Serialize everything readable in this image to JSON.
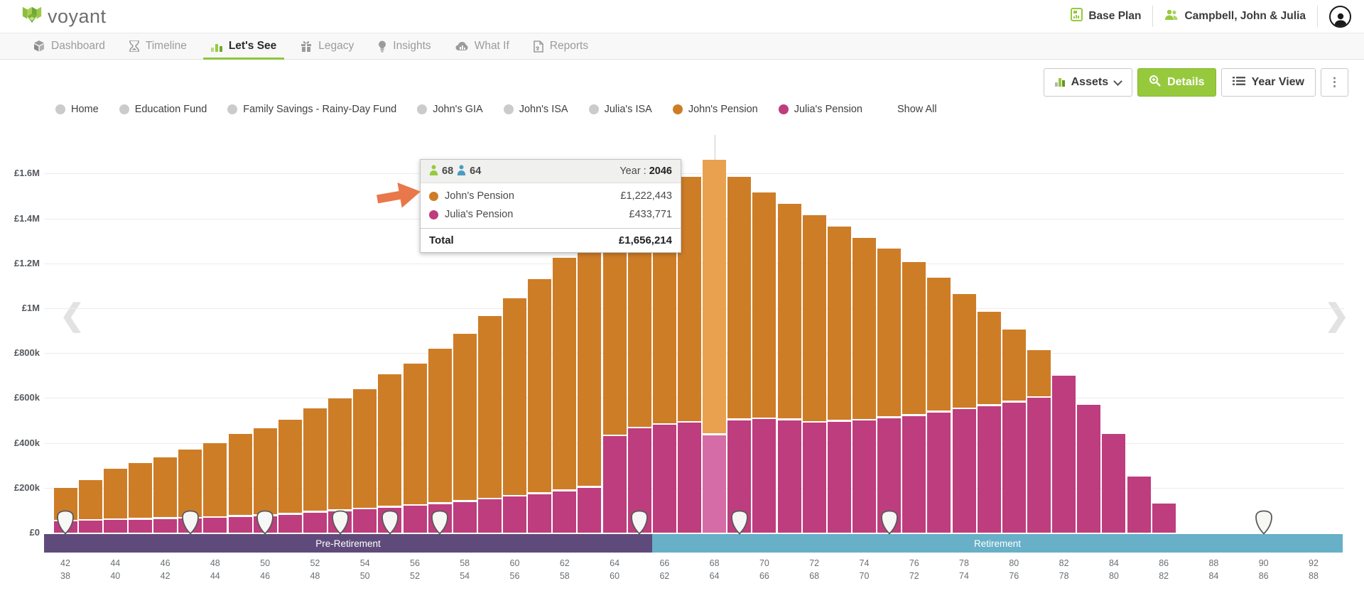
{
  "header": {
    "logo_text": "voyant",
    "plan_label": "Base Plan",
    "client_name": "Campbell, John & Julia"
  },
  "nav": {
    "items": [
      {
        "label": "Dashboard",
        "icon": "dashboard-cube-icon",
        "active": false
      },
      {
        "label": "Timeline",
        "icon": "hourglass-icon",
        "active": false
      },
      {
        "label": "Let's See",
        "icon": "bar-chart-icon",
        "active": true
      },
      {
        "label": "Legacy",
        "icon": "gift-icon",
        "active": false
      },
      {
        "label": "Insights",
        "icon": "lightbulb-icon",
        "active": false
      },
      {
        "label": "What If",
        "icon": "cloud-chart-icon",
        "active": false
      },
      {
        "label": "Reports",
        "icon": "report-document-icon",
        "active": false
      }
    ]
  },
  "toolbar": {
    "assets_label": "Assets",
    "details_label": "Details",
    "year_view_label": "Year View",
    "kebab_glyph": "⋮"
  },
  "legend": {
    "items": [
      {
        "label": "Home",
        "color": "#cbcbcb"
      },
      {
        "label": "Education Fund",
        "color": "#cbcbcb"
      },
      {
        "label": "Family Savings - Rainy-Day Fund",
        "color": "#cbcbcb"
      },
      {
        "label": "John's GIA",
        "color": "#cbcbcb"
      },
      {
        "label": "John's ISA",
        "color": "#cbcbcb"
      },
      {
        "label": "Julia's ISA",
        "color": "#cbcbcb"
      },
      {
        "label": "John's Pension",
        "color": "#ce7d27"
      },
      {
        "label": "Julia's Pension",
        "color": "#be3d7e"
      }
    ],
    "show_all_label": "Show All"
  },
  "tooltip": {
    "age_primary": "68",
    "age_secondary": "64",
    "year_label": "Year :",
    "year_value": "2046",
    "rows": [
      {
        "label": "John's Pension",
        "value": "£1,222,443",
        "color": "#ce7d27"
      },
      {
        "label": "Julia's Pension",
        "value": "£433,771",
        "color": "#be3d7e"
      }
    ],
    "total_label": "Total",
    "total_value": "£1,656,214"
  },
  "chart_data": {
    "type": "bar",
    "stacked": true,
    "title": "Let's See - Assets detail chart",
    "age_start_john": 42,
    "age_start_julia": 38,
    "series": [
      {
        "name": "Julia's Pension",
        "stack": "bottom",
        "color": "#be3d7e",
        "highlight_color": "#d66ca7",
        "values": [
          50000,
          53000,
          57000,
          58000,
          60000,
          63000,
          66000,
          70000,
          73000,
          80000,
          89000,
          96000,
          104000,
          112000,
          120000,
          128000,
          136000,
          148000,
          160000,
          172000,
          185000,
          200000,
          430000,
          465000,
          480000,
          490000,
          433771,
          500000,
          505000,
          500000,
          490000,
          495000,
          500000,
          510000,
          520000,
          535000,
          550000,
          565000,
          580000,
          600000,
          700000,
          570000,
          440000,
          250000,
          130000
        ]
      },
      {
        "name": "John's Pension",
        "stack": "top",
        "color": "#ce7d27",
        "highlight_color": "#e9a14f",
        "values": [
          145000,
          177000,
          223000,
          247000,
          270000,
          302000,
          329000,
          365000,
          387000,
          420000,
          461000,
          499000,
          531000,
          588000,
          630000,
          687000,
          744000,
          812000,
          880000,
          953000,
          1035000,
          1100000,
          960000,
          1010000,
          1065000,
          1090000,
          1222443,
          1080000,
          1005000,
          960000,
          920000,
          865000,
          810000,
          750000,
          680000,
          595000,
          510000,
          415000,
          320000,
          210000,
          0,
          0,
          0,
          0,
          0
        ]
      }
    ],
    "highlight_index": 26,
    "highlight_year": 2046,
    "ylim": [
      0,
      1700000
    ],
    "yticks": [
      {
        "label": "£0",
        "value": 0
      },
      {
        "label": "£200k",
        "value": 200000
      },
      {
        "label": "£400k",
        "value": 400000
      },
      {
        "label": "£600k",
        "value": 600000
      },
      {
        "label": "£800k",
        "value": 800000
      },
      {
        "label": "£1M",
        "value": 1000000
      },
      {
        "label": "£1.2M",
        "value": 1200000
      },
      {
        "label": "£1.4M",
        "value": 1400000
      },
      {
        "label": "£1.6M",
        "value": 1600000
      }
    ],
    "xticks": [
      [
        "42",
        "38"
      ],
      [
        "44",
        "40"
      ],
      [
        "46",
        "42"
      ],
      [
        "48",
        "44"
      ],
      [
        "50",
        "46"
      ],
      [
        "52",
        "48"
      ],
      [
        "54",
        "50"
      ],
      [
        "56",
        "52"
      ],
      [
        "58",
        "54"
      ],
      [
        "60",
        "56"
      ],
      [
        "62",
        "58"
      ],
      [
        "64",
        "60"
      ],
      [
        "66",
        "62"
      ],
      [
        "68",
        "64"
      ],
      [
        "70",
        "66"
      ],
      [
        "72",
        "68"
      ],
      [
        "74",
        "70"
      ],
      [
        "76",
        "72"
      ],
      [
        "78",
        "74"
      ],
      [
        "80",
        "76"
      ],
      [
        "82",
        "78"
      ],
      [
        "84",
        "80"
      ],
      [
        "86",
        "82"
      ],
      [
        "88",
        "84"
      ],
      [
        "90",
        "86"
      ],
      [
        "92",
        "88"
      ]
    ],
    "phases": [
      {
        "label": "Pre-Retirement",
        "color": "#5f4b7b",
        "start_age": 42,
        "end_age": 65
      },
      {
        "label": "Retirement",
        "color": "#67b0c7",
        "start_age": 66,
        "end_age": 93
      }
    ],
    "shield_event_ages": [
      42,
      47,
      50,
      53,
      55,
      57,
      65,
      69,
      75,
      90
    ],
    "grid": true,
    "legend_position": "top"
  }
}
